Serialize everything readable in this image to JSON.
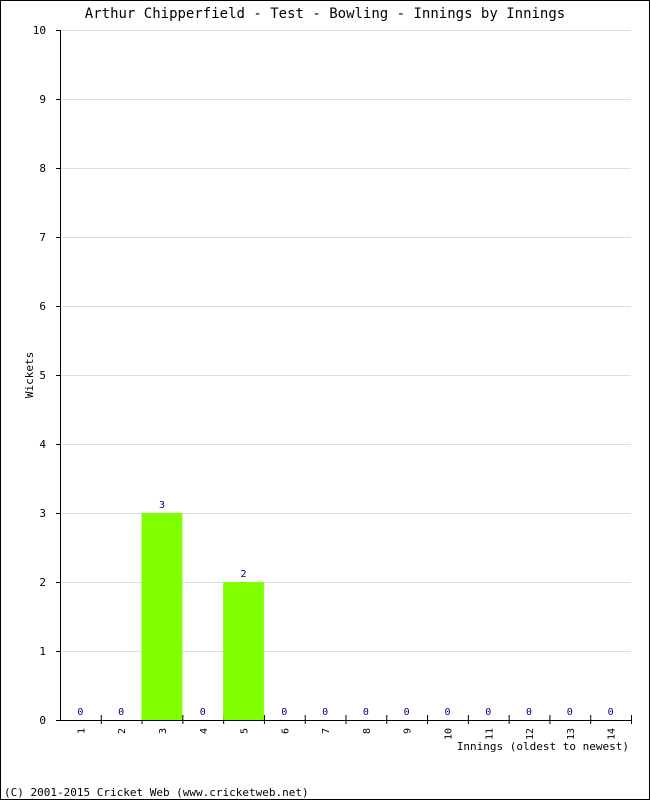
{
  "chart_data": {
    "type": "bar",
    "title": "Arthur Chipperfield - Test - Bowling - Innings by Innings",
    "xlabel": "Innings (oldest to newest)",
    "ylabel": "Wickets",
    "categories": [
      "1",
      "2",
      "3",
      "4",
      "5",
      "6",
      "7",
      "8",
      "9",
      "10",
      "11",
      "12",
      "13",
      "14"
    ],
    "values": [
      0,
      0,
      3,
      0,
      2,
      0,
      0,
      0,
      0,
      0,
      0,
      0,
      0,
      0
    ],
    "ylim": [
      0,
      10
    ],
    "yticks": [
      0,
      1,
      2,
      3,
      4,
      5,
      6,
      7,
      8,
      9,
      10
    ],
    "grid": true,
    "bar_color": "#80ff00",
    "label_color": "#000080"
  },
  "footer": "(C) 2001-2015 Cricket Web (www.cricketweb.net)"
}
